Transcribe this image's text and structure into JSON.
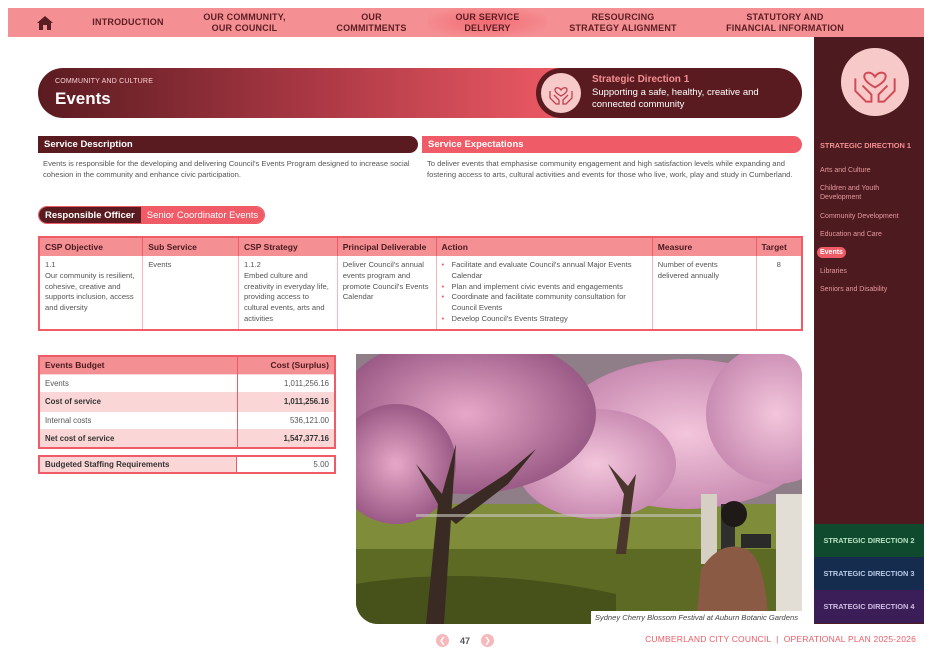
{
  "nav": {
    "items": [
      {
        "label": "INTRODUCTION"
      },
      {
        "label": "OUR COMMUNITY,\nOUR COUNCIL"
      },
      {
        "label": "OUR\nCOMMITMENTS"
      },
      {
        "label": "OUR SERVICE\nDELIVERY"
      },
      {
        "label": "RESOURCING\nSTRATEGY ALIGNMENT"
      },
      {
        "label": "STATUTORY AND\nFINANCIAL INFORMATION"
      }
    ],
    "active_index": 3,
    "home_icon": "home-icon"
  },
  "header": {
    "eyebrow": "COMMUNITY AND CULTURE",
    "title": "Events",
    "strategic_direction": {
      "title": "Strategic Direction 1",
      "text": "Supporting a safe, healthy, creative and connected community",
      "icon": "hands-heart-icon"
    }
  },
  "service_description": {
    "heading": "Service Description",
    "text": "Events is responsible for the developing and delivering Council's Events Program designed to increase social cohesion in the community and enhance civic participation."
  },
  "service_expectations": {
    "heading": "Service Expectations",
    "text": "To deliver events that emphasise community engagement and high satisfaction levels while expanding and fostering access to arts, cultural activities and events for those who live, work, play and study in Cumberland."
  },
  "officer": {
    "label": "Responsible Officer",
    "value": "Senior Coordinator Events"
  },
  "csp_table": {
    "headers": [
      "CSP Objective",
      "Sub Service",
      "CSP Strategy",
      "Principal Deliverable",
      "Action",
      "Measure",
      "Target"
    ],
    "row": {
      "objective_code": "1.1",
      "objective": "Our community is resilient, cohesive, creative and supports inclusion, access and diversity",
      "sub_service": "Events",
      "strategy_code": "1.1.2",
      "strategy": "Embed culture and creativity in everyday life, providing access to cultural events, arts and activities",
      "deliverable": "Deliver Council's annual events program and promote Council's Events Calendar",
      "actions": [
        "Facilitate and evaluate Council's annual Major Events Calendar",
        "Plan and implement civic events and engagements",
        "Coordinate and facilitate community consultation for Council Events",
        "Develop Council's Events Strategy"
      ],
      "measure": "Number of events delivered annually",
      "target": "8"
    }
  },
  "budget": {
    "header_label": "Events Budget",
    "header_value": "Cost (Surplus)",
    "rows": [
      {
        "label": "Events",
        "value": "1,011,256.16"
      },
      {
        "label": "Cost of service",
        "value": "1,011,256.16"
      },
      {
        "label": "Internal costs",
        "value": "536,121.00"
      },
      {
        "label": "Net cost of service",
        "value": "1,547,377.16"
      }
    ],
    "staffing_label": "Budgeted Staffing Requirements",
    "staffing_value": "5.00"
  },
  "photo": {
    "caption": "Sydney Cherry Blossom Festival at Auburn Botanic Gardens"
  },
  "sidebar": {
    "heading": "STRATEGIC DIRECTION 1",
    "items": [
      {
        "label": "Arts and Culture"
      },
      {
        "label": "Children and Youth Development"
      },
      {
        "label": "Community Development"
      },
      {
        "label": "Education and Care"
      },
      {
        "label": "Events"
      },
      {
        "label": "Libraries"
      },
      {
        "label": "Seniors and Disability"
      }
    ],
    "active_index": 4,
    "directions": [
      {
        "label": "STRATEGIC DIRECTION 2",
        "color": "#0f4a2e"
      },
      {
        "label": "STRATEGIC DIRECTION 3",
        "color": "#152c4f"
      },
      {
        "label": "STRATEGIC DIRECTION 4",
        "color": "#3b1e57"
      }
    ]
  },
  "footer": {
    "page_number": "47",
    "text": "CUMBERLAND CITY COUNCIL  |  OPERATIONAL PLAN 2025-2026"
  },
  "colors": {
    "accent": "#ef5b66",
    "light_accent": "#f48f93",
    "dark": "#4c1a1f"
  }
}
